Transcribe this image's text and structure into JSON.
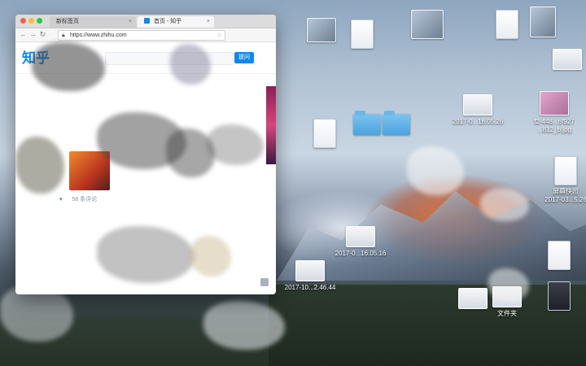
{
  "browser": {
    "tabs": [
      {
        "label": "新标签页"
      },
      {
        "label": "首页 - 知乎"
      }
    ],
    "url": "https://www.zhihu.com",
    "page": {
      "logo": "知乎",
      "ask_button": "提问",
      "upvote_chevron": "▾",
      "comments_label": "58 条评论"
    }
  },
  "desktop": {
    "icons": [
      {
        "label": "2017-0...16.05.26",
        "type": "screenshot"
      },
      {
        "label": "2017-0...16.05.16",
        "type": "screenshot"
      },
      {
        "label": "2017-10...2.46.44",
        "type": "screenshot"
      },
      {
        "label": "屏幕快照\n2017-03...5.26",
        "type": "screenshot"
      },
      {
        "label": "文件夹",
        "type": "folder"
      },
      {
        "label": "f2-448...6f927\n...812_b.jpg",
        "type": "image"
      }
    ]
  },
  "colors": {
    "zhihu_blue": "#0f88eb",
    "close": "#fc5f57",
    "minimize": "#fdbc2e",
    "zoom": "#28c840"
  }
}
